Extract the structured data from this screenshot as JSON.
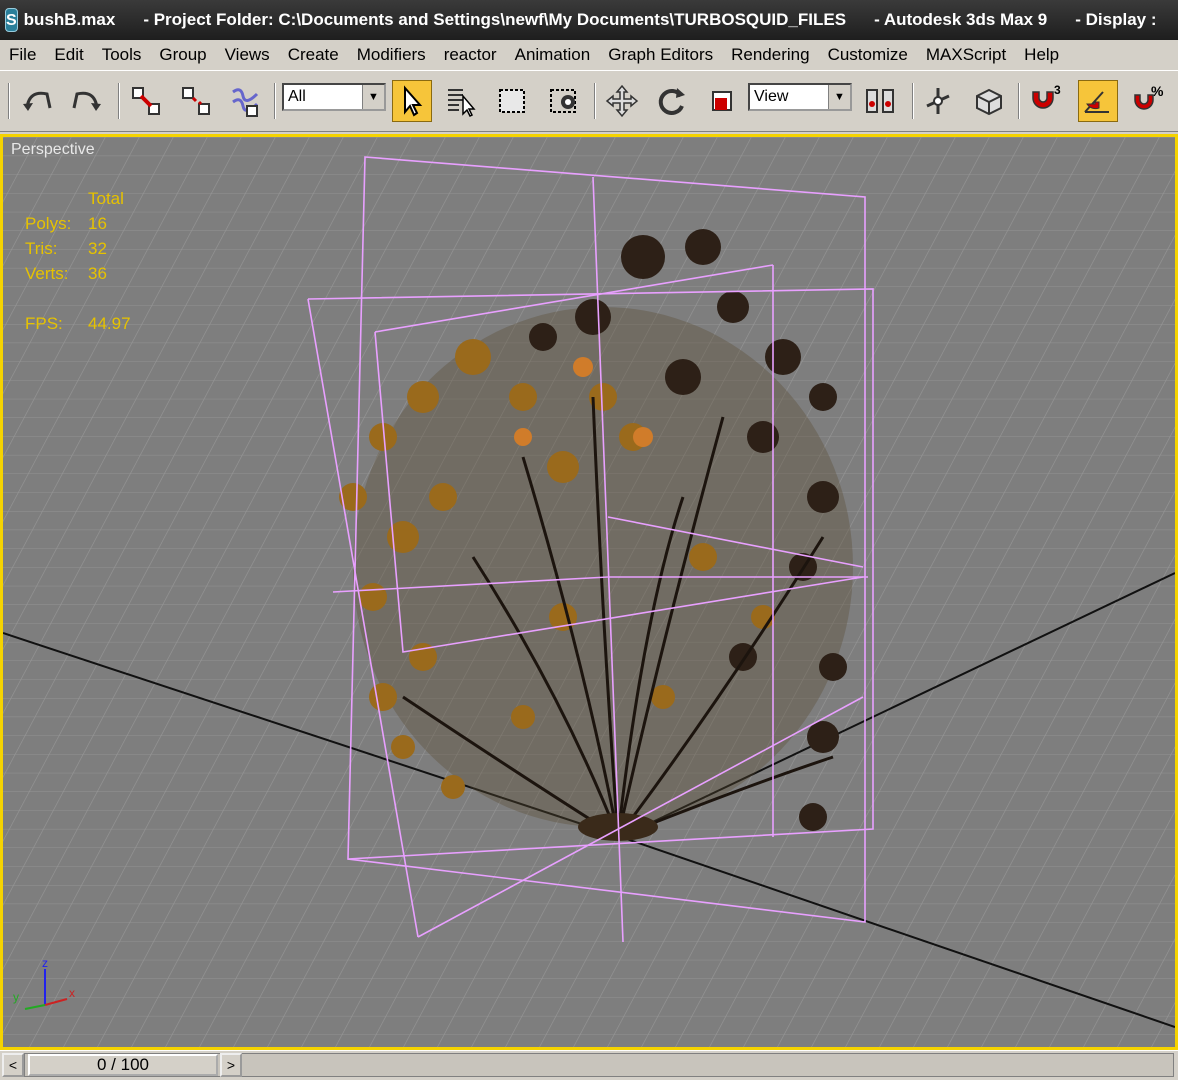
{
  "title_bar": {
    "file": "bushB.max",
    "project": "- Project Folder: C:\\Documents and Settings\\newf\\My Documents\\TURBOSQUID_FILES",
    "app": "- Autodesk 3ds Max 9",
    "display": "- Display :"
  },
  "menu": [
    "File",
    "Edit",
    "Tools",
    "Group",
    "Views",
    "Create",
    "Modifiers",
    "reactor",
    "Animation",
    "Graph Editors",
    "Rendering",
    "Customize",
    "MAXScript",
    "Help"
  ],
  "toolbar": {
    "selection_filter": "All",
    "reference_coord": "View",
    "snap_label": "3",
    "percent_snap_label": "%"
  },
  "viewport": {
    "label": "Perspective",
    "stats": {
      "header": "Total",
      "polys_label": "Polys:",
      "polys": "16",
      "tris_label": "Tris:",
      "tris": "32",
      "verts_label": "Verts:",
      "verts": "36",
      "fps_label": "FPS:",
      "fps": "44.97"
    },
    "axis": {
      "x": "x",
      "y": "y",
      "z": "z"
    }
  },
  "time_slider": {
    "value": "0 / 100",
    "prev": "<",
    "next": ">"
  },
  "colors": {
    "viewport_bg": "#7e7e7e",
    "active_border": "#f5d300",
    "stats_text": "#e6c200",
    "selection_box": "#e8a0ff"
  }
}
